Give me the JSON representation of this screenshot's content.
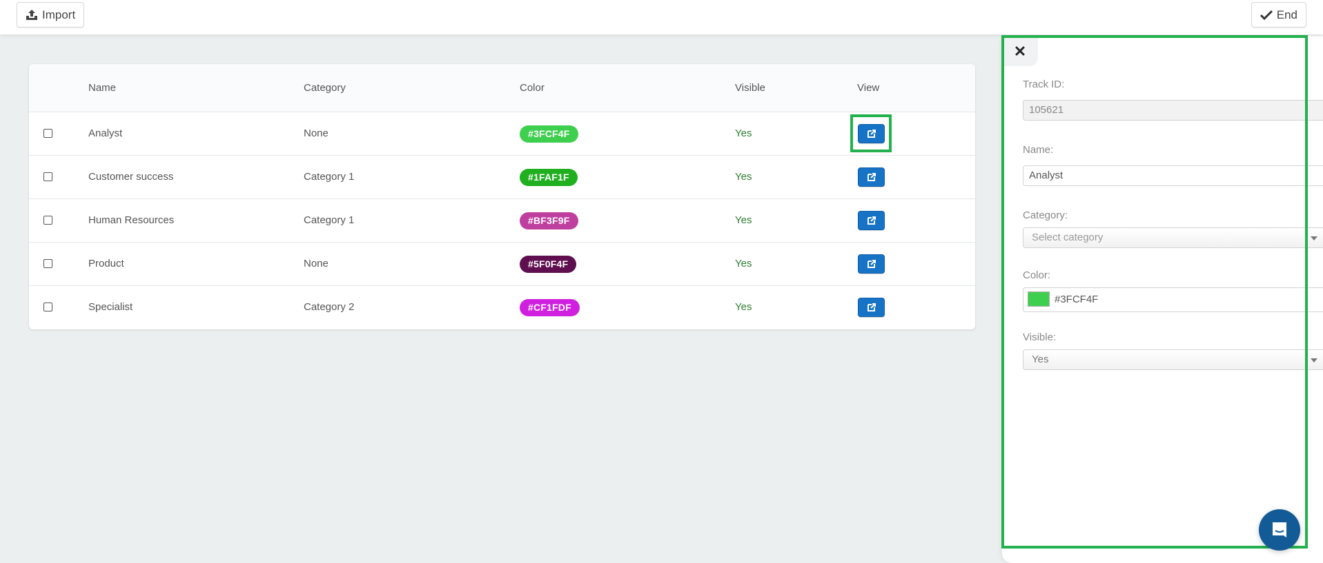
{
  "toolbar": {
    "import_label": "Import",
    "end_label": "End",
    "import_icon": "upload-icon",
    "end_icon": "check-icon"
  },
  "table": {
    "columns": [
      "",
      "Name",
      "Category",
      "Color",
      "Visible",
      "View"
    ],
    "rows": [
      {
        "name": "Analyst",
        "category": "None",
        "color": "#3FCF4F",
        "visible": "Yes"
      },
      {
        "name": "Customer success",
        "category": "Category 1",
        "color": "#1FAF1F",
        "visible": "Yes"
      },
      {
        "name": "Human Resources",
        "category": "Category 1",
        "color": "#BF3F9F",
        "visible": "Yes"
      },
      {
        "name": "Product",
        "category": "None",
        "color": "#5F0F4F",
        "visible": "Yes"
      },
      {
        "name": "Specialist",
        "category": "Category 2",
        "color": "#CF1FDF",
        "visible": "Yes"
      }
    ],
    "view_icon": "external-link-icon"
  },
  "panel": {
    "close_icon": "close-icon",
    "track_id_label": "Track ID:",
    "track_id_value": "105621",
    "name_label": "Name:",
    "name_value": "Analyst",
    "category_label": "Category:",
    "category_placeholder": "Select category",
    "color_label": "Color:",
    "color_value": "#3FCF4F",
    "visible_label": "Visible:",
    "visible_value": "Yes"
  },
  "chat": {
    "icon": "chat-icon"
  },
  "colors": {
    "highlight": "#22B14C",
    "view_button": "#1673C5",
    "visible_yes": "#2E7D32",
    "chat_button": "#135B96"
  }
}
